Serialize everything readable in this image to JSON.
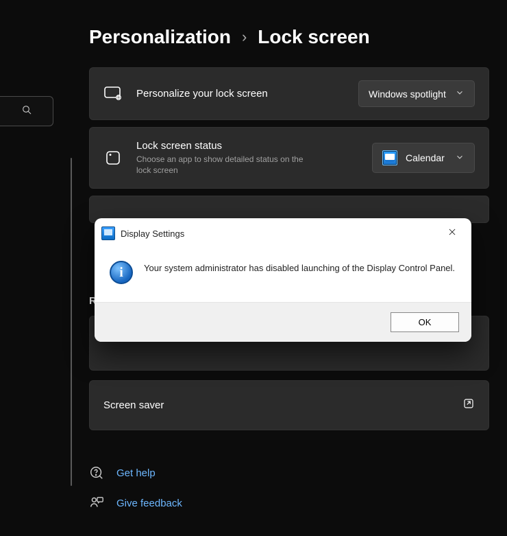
{
  "breadcrumb": {
    "parent": "Personalization",
    "separator": "›",
    "current": "Lock screen"
  },
  "search": {
    "placeholder": ""
  },
  "cards": {
    "personalize": {
      "title": "Personalize your lock screen",
      "dropdown_value": "Windows spotlight"
    },
    "status": {
      "title": "Lock screen status",
      "subtitle": "Choose an app to show detailed status on the lock screen",
      "dropdown_value": "Calendar"
    },
    "screensaver": {
      "title": "Screen saver"
    }
  },
  "related_label_partial": "R",
  "help": {
    "get_help": "Get help",
    "feedback": "Give feedback"
  },
  "dialog": {
    "title": "Display Settings",
    "message": "Your system administrator has disabled launching of the Display Control Panel.",
    "ok_label": "OK"
  }
}
